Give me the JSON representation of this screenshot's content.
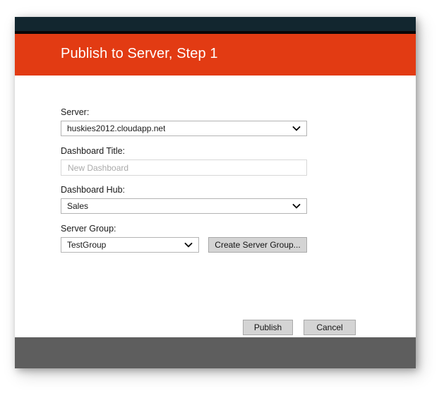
{
  "window": {
    "title": "Publish to Server, Step 1",
    "accent_color": "#e23b13",
    "titlebar_color": "#12262f",
    "footer_color": "#5e5e5e"
  },
  "form": {
    "server": {
      "label": "Server:",
      "value": "huskies2012.cloudapp.net",
      "arrow_icon": "chevron-down-icon"
    },
    "dashboard_title": {
      "label": "Dashboard Title:",
      "value": "",
      "placeholder": "New Dashboard"
    },
    "dashboard_hub": {
      "label": "Dashboard Hub:",
      "value": "Sales",
      "arrow_icon": "chevron-down-icon"
    },
    "server_group": {
      "label": "Server Group:",
      "value": "TestGroup",
      "arrow_icon": "chevron-down-icon",
      "create_button_label": "Create Server Group..."
    }
  },
  "actions": {
    "publish_label": "Publish",
    "cancel_label": "Cancel"
  }
}
